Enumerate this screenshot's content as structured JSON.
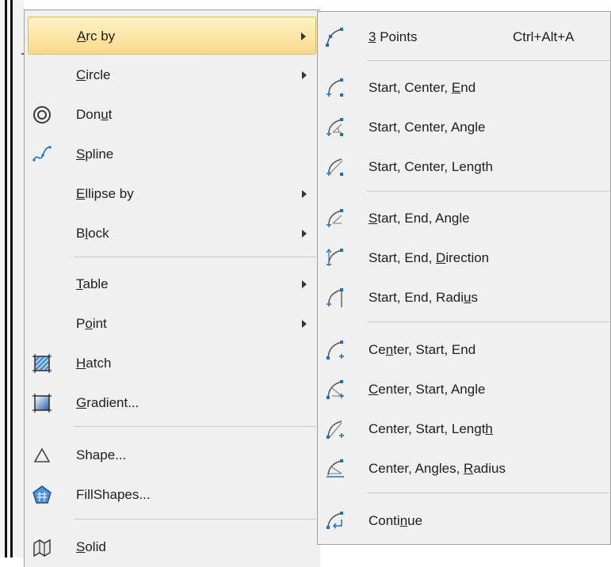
{
  "main_menu": {
    "items": [
      {
        "pre": "",
        "mn": "A",
        "post": "rc by",
        "submenu": true,
        "highlight": true,
        "icon": "none"
      },
      {
        "pre": "",
        "mn": "C",
        "post": "ircle",
        "submenu": true,
        "icon": "none"
      },
      {
        "pre": "Don",
        "mn": "u",
        "post": "t",
        "submenu": false,
        "icon": "donut-icon"
      },
      {
        "pre": "",
        "mn": "S",
        "post": "pline",
        "submenu": false,
        "icon": "spline-icon"
      },
      {
        "pre": "",
        "mn": "E",
        "post": "llipse by",
        "submenu": true,
        "icon": "none"
      },
      {
        "pre": "B",
        "mn": "l",
        "post": "ock",
        "submenu": true,
        "icon": "none"
      },
      {
        "pre": "",
        "mn": "T",
        "post": "able",
        "submenu": true,
        "icon": "none"
      },
      {
        "pre": "P",
        "mn": "o",
        "post": "int",
        "submenu": true,
        "icon": "none"
      },
      {
        "pre": "",
        "mn": "H",
        "post": "atch",
        "submenu": false,
        "icon": "hatch-icon"
      },
      {
        "pre": "",
        "mn": "G",
        "post": "radient...",
        "submenu": false,
        "icon": "gradient-icon"
      },
      {
        "pre": "Shape...",
        "mn": "",
        "post": "",
        "submenu": false,
        "icon": "triangle-icon"
      },
      {
        "pre": "FillShapes...",
        "mn": "",
        "post": "",
        "submenu": false,
        "icon": "fillshapes-icon"
      },
      {
        "pre": "",
        "mn": "S",
        "post": "olid",
        "submenu": false,
        "icon": "solid-icon"
      }
    ]
  },
  "arc_submenu": {
    "items": [
      {
        "pre": "",
        "mn": "3",
        "post": " Points",
        "shortcut": "Ctrl+Alt+A",
        "icon": "arc-3points-icon"
      },
      {
        "pre": "Start, Center, ",
        "mn": "E",
        "post": "nd",
        "icon": "arc-start-center-end-icon"
      },
      {
        "pre": "Start, Center, An",
        "mn": "g",
        "post": "le",
        "icon": "arc-start-center-angle-icon"
      },
      {
        "pre": "Start, Center, Len",
        "mn": "g",
        "post": "th",
        "icon": "arc-start-center-length-icon"
      },
      {
        "pre": "",
        "mn": "S",
        "post": "tart, End, Angle",
        "icon": "arc-start-end-angle-icon"
      },
      {
        "pre": "Start, End, ",
        "mn": "D",
        "post": "irection",
        "icon": "arc-start-end-direction-icon"
      },
      {
        "pre": "Start, End, Radi",
        "mn": "u",
        "post": "s",
        "icon": "arc-start-end-radius-icon"
      },
      {
        "pre": "Ce",
        "mn": "n",
        "post": "ter, Start, End",
        "icon": "arc-center-start-end-icon"
      },
      {
        "pre": "",
        "mn": "C",
        "post": "enter, Start, Angle",
        "icon": "arc-center-start-angle-icon"
      },
      {
        "pre": "Center, Start, Lengt",
        "mn": "h",
        "post": "",
        "icon": "arc-center-start-length-icon"
      },
      {
        "pre": "Center, Angles, ",
        "mn": "R",
        "post": "adius",
        "icon": "arc-center-angles-radius-icon"
      },
      {
        "pre": "Conti",
        "mn": "n",
        "post": "ue",
        "icon": "arc-continue-icon"
      }
    ]
  }
}
